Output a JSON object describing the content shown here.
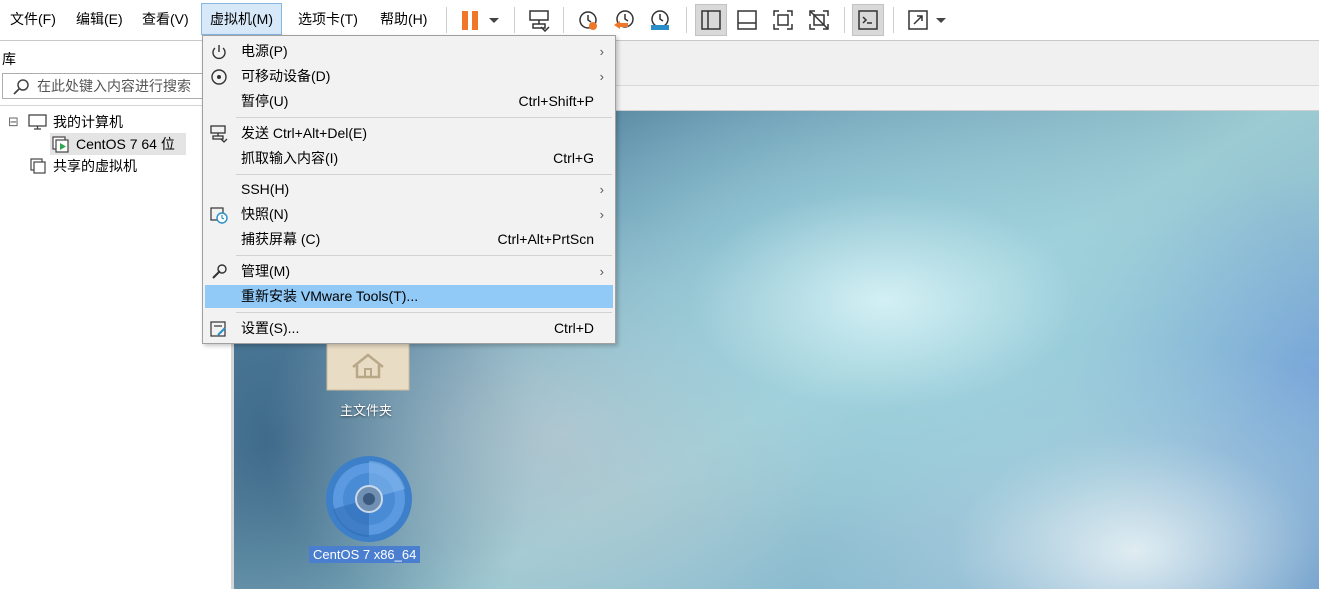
{
  "menubar": {
    "items": [
      "文件(F)",
      "编辑(E)",
      "查看(V)",
      "虚拟机(M)",
      "选项卡(T)",
      "帮助(H)"
    ],
    "active_index": 3
  },
  "toolbar": {
    "pause_color": "#f0772a",
    "icons": [
      "pause-icon",
      "dropdown-arrow-icon",
      "send-ctrl-alt-del-icon",
      "snapshot-icon",
      "revert-snapshot-icon",
      "manage-snapshots-icon",
      "show-library-icon",
      "thumbnail-bar-icon",
      "fit-guest-icon",
      "unity-off-icon",
      "console-view-icon",
      "fullscreen-icon"
    ]
  },
  "library": {
    "title": "库",
    "search_placeholder": "在此处键入内容进行搜索",
    "tree": {
      "toggle": "⊟",
      "my_computer": "我的计算机",
      "vm": "CentOS 7 64 位",
      "shared": "共享的虚拟机"
    }
  },
  "vm_menu": {
    "items": [
      {
        "label": "电源(P)",
        "shortcut": "",
        "submenu": true
      },
      {
        "label": "可移动设备(D)",
        "shortcut": "",
        "submenu": true
      },
      {
        "label": "暂停(U)",
        "shortcut": "Ctrl+Shift+P",
        "submenu": false
      },
      {
        "label": "发送 Ctrl+Alt+Del(E)",
        "shortcut": "",
        "submenu": false
      },
      {
        "label": "抓取输入内容(I)",
        "shortcut": "Ctrl+G",
        "submenu": false
      },
      {
        "label": "SSH(H)",
        "shortcut": "",
        "submenu": true
      },
      {
        "label": "快照(N)",
        "shortcut": "",
        "submenu": true
      },
      {
        "label": "捕获屏幕 (C)",
        "shortcut": "Ctrl+Alt+PrtScn",
        "submenu": false
      },
      {
        "label": "管理(M)",
        "shortcut": "",
        "submenu": true
      },
      {
        "label": "重新安装 VMware Tools(T)...",
        "shortcut": "",
        "submenu": false
      },
      {
        "label": "设置(S)...",
        "shortcut": "Ctrl+D",
        "submenu": false
      }
    ],
    "arrow_glyph": "›",
    "highlight_index": 9,
    "highlight_color": "#91c9f7"
  },
  "desktop": {
    "home_folder_label": "主文件夹",
    "disc_label": "CentOS 7 x86_64"
  }
}
